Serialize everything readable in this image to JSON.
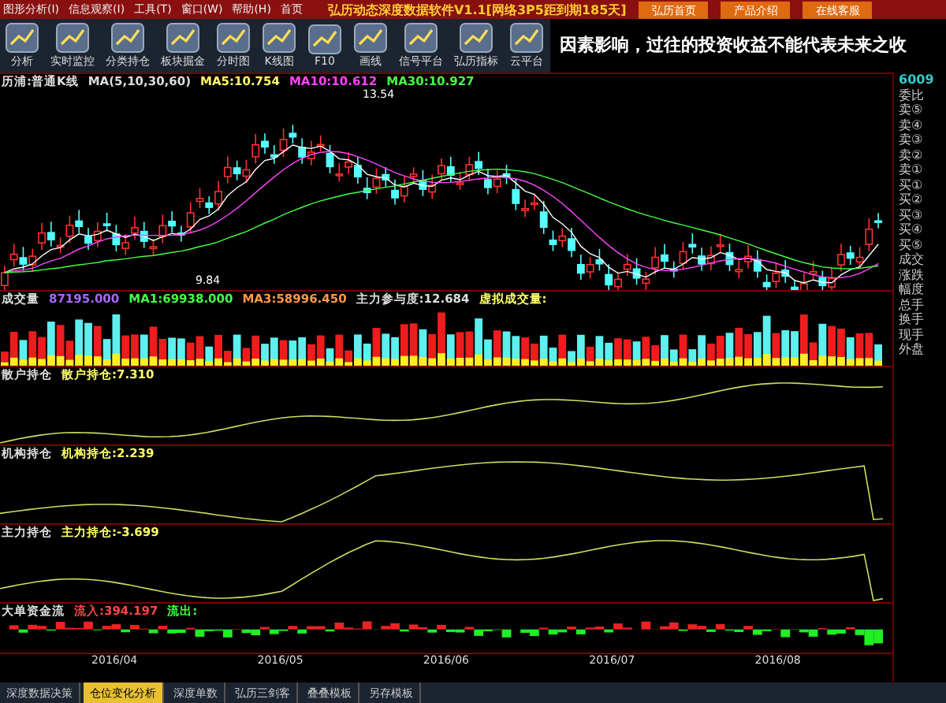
{
  "menu_bar": {
    "items": [
      "图形分析(I)",
      "信息观察(I)",
      "工具(T)",
      "窗口(W)",
      "帮助(H)",
      "首页"
    ],
    "title": "弘历动态深度数据软件V1.1[网络3P5距到期185天]",
    "links": [
      "弘历首页",
      "产品介绍",
      "在线客服"
    ]
  },
  "toolbar": {
    "items": [
      {
        "label": "分析"
      },
      {
        "label": "实时监控"
      },
      {
        "label": "分类持仓"
      },
      {
        "label": "板块掘金"
      },
      {
        "label": "分时图"
      },
      {
        "label": "K线图"
      },
      {
        "label": "F10"
      },
      {
        "label": "画线"
      },
      {
        "label": "信号平台"
      },
      {
        "label": "弘历指标"
      },
      {
        "label": "云平台"
      }
    ],
    "ticker_text": "因素影响，过往的投资收益不能代表未来之收"
  },
  "main_chart": {
    "title": "历浦:普通K线",
    "readings": [
      {
        "label": "MA(5,10,30,60)",
        "color": "#dddddd"
      },
      {
        "label": "MA5:10.754",
        "color": "#ffff66"
      },
      {
        "label": "MA10:10.612",
        "color": "#ff44ff"
      },
      {
        "label": "MA30:10.927",
        "color": "#44ff44"
      }
    ],
    "high_label": "13.54",
    "low_label": "9.84"
  },
  "volume_panel": {
    "title": "成交量",
    "readings": [
      {
        "label": "87195.000",
        "color": "#aa66ff"
      },
      {
        "label": "MA1:69938.000",
        "color": "#44ff44"
      },
      {
        "label": "MA3:58996.450",
        "color": "#ff9944"
      },
      {
        "label": "主力参与度:12.684",
        "color": "#dddddd"
      },
      {
        "label": "虚拟成交量:",
        "color": "#ffff66"
      }
    ]
  },
  "indicator_panels": [
    {
      "kind": "line",
      "title": "散户持仓",
      "readings": [
        {
          "label": "散户持仓:7.310",
          "color": "#ffff66"
        }
      ]
    },
    {
      "kind": "line",
      "title": "机构持仓",
      "readings": [
        {
          "label": "机构持仓:2.239",
          "color": "#ffff66"
        }
      ]
    },
    {
      "kind": "line",
      "title": "主力持仓",
      "readings": [
        {
          "label": "主力持仓:-3.699",
          "color": "#ffff66"
        }
      ]
    },
    {
      "kind": "bars",
      "title": "大单资金流",
      "readings": [
        {
          "label": "流入:394.197",
          "color": "#ff4444"
        },
        {
          "label": "流出:",
          "color": "#44ff44"
        }
      ]
    }
  ],
  "date_axis": [
    "2016/04",
    "2016/05",
    "2016/06",
    "2016/07",
    "2016/08"
  ],
  "right_panel": {
    "code": "6009",
    "labels": [
      "委比",
      "卖⑤",
      "卖④",
      "卖③",
      "卖②",
      "卖①",
      "买①",
      "买②",
      "买③",
      "买④",
      "买⑤",
      "成交",
      "涨跌",
      "幅度",
      "总手",
      "换手",
      "现手",
      "外盘"
    ]
  },
  "bottom_tabs": [
    {
      "label": "深度数据决策",
      "selected": false
    },
    {
      "label": "仓位变化分析",
      "selected": true
    },
    {
      "label": "深度单数",
      "selected": false
    },
    {
      "label": "弘历三剑客",
      "selected": false
    },
    {
      "label": "叠叠模板",
      "selected": false
    },
    {
      "label": "另存模板",
      "selected": false
    }
  ]
}
